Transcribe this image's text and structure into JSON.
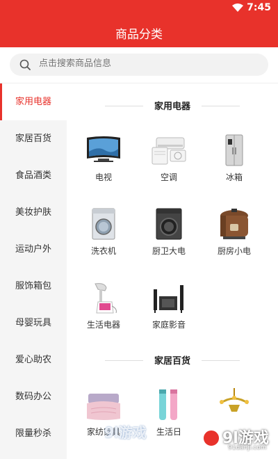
{
  "status": {
    "time": "7:45"
  },
  "header": {
    "title": "商品分类"
  },
  "search": {
    "placeholder": "点击搜索商品信息"
  },
  "sidebar": {
    "items": [
      {
        "label": "家用电器",
        "active": true
      },
      {
        "label": "家居百货"
      },
      {
        "label": "食品酒类"
      },
      {
        "label": "美妆护肤"
      },
      {
        "label": "运动户外"
      },
      {
        "label": "服饰箱包"
      },
      {
        "label": "母婴玩具"
      },
      {
        "label": "爱心助农"
      },
      {
        "label": "数码办公"
      },
      {
        "label": "限量秒杀"
      }
    ]
  },
  "sections": [
    {
      "title": "家用电器",
      "items": [
        {
          "label": "电视",
          "icon": "tv-icon"
        },
        {
          "label": "空调",
          "icon": "air-conditioner-icon"
        },
        {
          "label": "冰箱",
          "icon": "fridge-icon"
        },
        {
          "label": "洗衣机",
          "icon": "washing-machine-icon"
        },
        {
          "label": "厨卫大电",
          "icon": "kitchen-appliance-icon"
        },
        {
          "label": "厨房小电",
          "icon": "rice-cooker-icon"
        },
        {
          "label": "生活电器",
          "icon": "garment-steamer-icon"
        },
        {
          "label": "家庭影音",
          "icon": "home-theater-icon"
        }
      ]
    },
    {
      "title": "家居百货",
      "items": [
        {
          "label": "家纺家具",
          "icon": "bedding-icon"
        },
        {
          "label": "生活日",
          "icon": "thermos-icon"
        },
        {
          "label": "",
          "icon": "chandelier-icon"
        }
      ]
    }
  ],
  "watermark": {
    "text": "9l游戏",
    "url": "91danji.com",
    "overlay": "9l游戏"
  },
  "colors": {
    "accent": "#e8322b",
    "sidebar_bg": "#f5f5f5"
  }
}
